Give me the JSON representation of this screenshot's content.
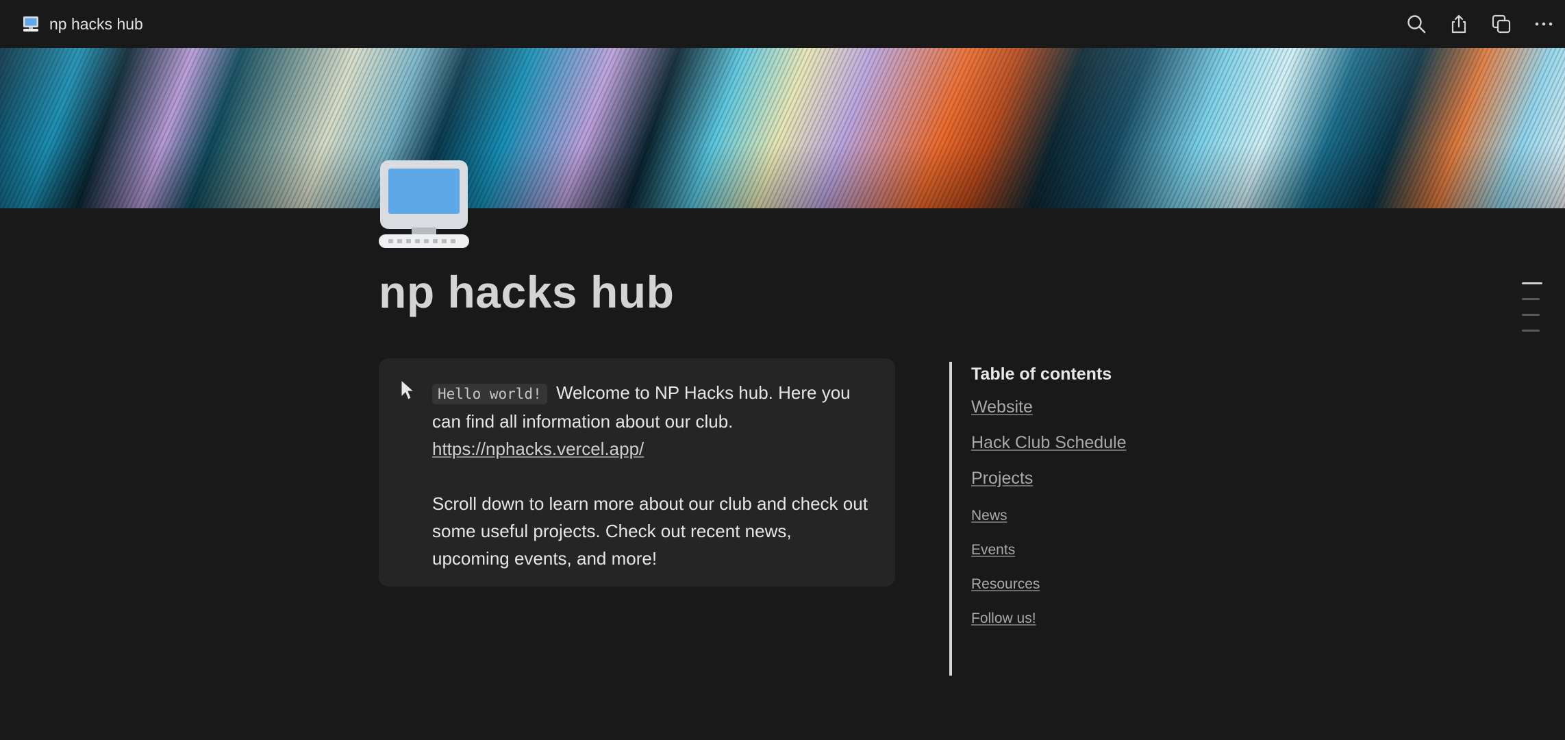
{
  "topbar": {
    "title": "np hacks hub",
    "page_icon": "computer-icon",
    "actions": [
      {
        "name": "search-icon"
      },
      {
        "name": "share-icon"
      },
      {
        "name": "duplicate-icon"
      },
      {
        "name": "more-icon"
      }
    ]
  },
  "page": {
    "title": "np hacks hub",
    "icon": "computer-icon"
  },
  "callout": {
    "icon": "cursor-icon",
    "code": "Hello world!",
    "text1": " Welcome to NP Hacks hub. Here you can find all information about our club.",
    "link": "https://nphacks.vercel.app/",
    "text2": "Scroll down to learn more about our club and check out some useful projects. Check out recent news, upcoming events, and more!"
  },
  "toc": {
    "heading": "Table of contents",
    "items": [
      {
        "label": "Website",
        "level": 1
      },
      {
        "label": "Hack Club Schedule",
        "level": 1
      },
      {
        "label": "Projects",
        "level": 1
      },
      {
        "label": "News",
        "level": 2
      },
      {
        "label": "Events",
        "level": 2
      },
      {
        "label": "Resources",
        "level": 2
      },
      {
        "label": "Follow us!",
        "level": 2
      }
    ]
  },
  "colors": {
    "background": "#191919",
    "callout_bg": "#252525",
    "monitor_screen": "#5ea8e8",
    "monitor_frame": "#d9dde2"
  }
}
